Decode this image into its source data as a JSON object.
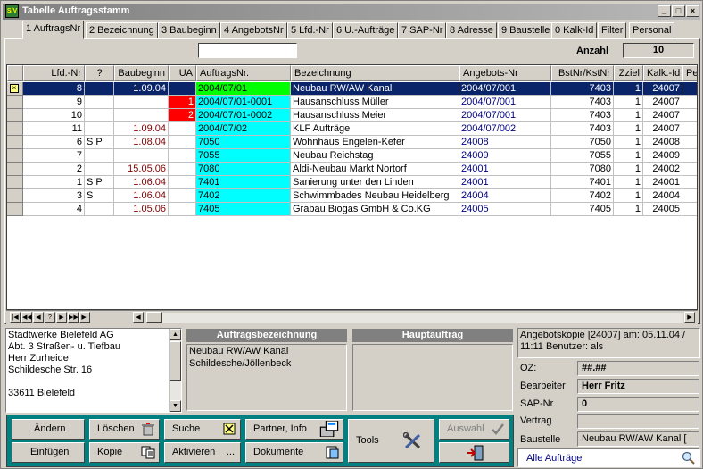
{
  "window": {
    "title": "Tabelle Auftragsstamm",
    "icon_text": "S/V"
  },
  "tabs": [
    "1 AuftragsNr",
    "2 Bezeichnung",
    "3 Baubeginn",
    "4 AngebotsNr",
    "5 Lfd.-Nr",
    "6 U.-Aufträge",
    "7 SAP-Nr",
    "8 Adresse",
    "9 Baustelle",
    "0 Kalk-Id",
    "Filter",
    "Personal"
  ],
  "anzahl": {
    "label": "Anzahl",
    "value": "10"
  },
  "grid": {
    "headers": [
      "Lfd.-Nr",
      "?",
      "Baubeginn",
      "UA",
      "AuftragsNr.",
      "Bezeichnung",
      "Angebots-Nr",
      "BstNr/KstNr",
      "Zziel",
      "Kalk.-Id",
      "Per"
    ],
    "rows": [
      {
        "lfd": "8",
        "q": "",
        "beginn": "1.09.04",
        "ua": "",
        "nr": "2004/07/01",
        "bez": "Neubau RW/AW Kanal",
        "ang": "2004/07/001",
        "bst": "7403",
        "z": "1",
        "kalk": "24007"
      },
      {
        "lfd": "9",
        "q": "",
        "beginn": "",
        "ua": "1",
        "nr": "2004/07/01-0001",
        "bez": "Hausanschluss Müller",
        "ang": "2004/07/001",
        "bst": "7403",
        "z": "1",
        "kalk": "24007"
      },
      {
        "lfd": "10",
        "q": "",
        "beginn": "",
        "ua": "2",
        "nr": "2004/07/01-0002",
        "bez": "Hausanschluss Meier",
        "ang": "2004/07/001",
        "bst": "7403",
        "z": "1",
        "kalk": "24007"
      },
      {
        "lfd": "11",
        "q": "",
        "beginn": "1.09.04",
        "ua": "",
        "nr": "2004/07/02",
        "bez": "KLF Aufträge",
        "ang": "2004/07/002",
        "bst": "7403",
        "z": "1",
        "kalk": "24007"
      },
      {
        "lfd": "6",
        "q": "S P",
        "beginn": "1.08.04",
        "ua": "",
        "nr": "7050",
        "bez": "Wohnhaus Engelen-Kefer",
        "ang": "24008",
        "bst": "7050",
        "z": "1",
        "kalk": "24008"
      },
      {
        "lfd": "7",
        "q": "",
        "beginn": "",
        "ua": "",
        "nr": "7055",
        "bez": "Neubau Reichstag",
        "ang": "24009",
        "bst": "7055",
        "z": "1",
        "kalk": "24009"
      },
      {
        "lfd": "2",
        "q": "",
        "beginn": "15.05.06",
        "ua": "",
        "nr": "7080",
        "bez": "Aldi-Neubau Markt Nortorf",
        "ang": "24001",
        "bst": "7080",
        "z": "1",
        "kalk": "24002"
      },
      {
        "lfd": "1",
        "q": "S P",
        "beginn": "1.06.04",
        "ua": "",
        "nr": "7401",
        "bez": "Sanierung unter den Linden",
        "ang": "24001",
        "bst": "7401",
        "z": "1",
        "kalk": "24001"
      },
      {
        "lfd": "3",
        "q": "S",
        "beginn": "1.06.04",
        "ua": "",
        "nr": "7402",
        "bez": "Schwimmbades Neubau Heidelberg",
        "ang": "24004",
        "bst": "7402",
        "z": "1",
        "kalk": "24004"
      },
      {
        "lfd": "4",
        "q": "",
        "beginn": "1.05.06",
        "ua": "",
        "nr": "7405",
        "bez": "Grabau Biogas GmbH & Co.KG",
        "ang": "24005",
        "bst": "7405",
        "z": "1",
        "kalk": "24005"
      }
    ]
  },
  "address": [
    "Stadtwerke Bielefeld AG",
    "Abt. 3 Straßen- u. Tiefbau",
    "Herr Zurheide",
    "Schildesche Str. 16",
    "",
    "33611 Bielefeld"
  ],
  "auftragsbezeichnung": {
    "header": "Auftragsbezeichnung",
    "lines": [
      "Neubau RW/AW Kanal",
      "Schildesche/Jöllenbeck"
    ]
  },
  "hauptauftrag": {
    "header": "Hauptauftrag"
  },
  "info": {
    "text": "Angebotskopie [24007] am: 05.11.04 / 11:11   Benutzer: als"
  },
  "fields": {
    "oz_label": "OZ:",
    "oz": "##.##",
    "bearbeiter_label": "Bearbeiter",
    "bearbeiter": "Herr Fritz",
    "sap_label": "SAP-Nr",
    "sap": "0",
    "vertrag_label": "Vertrag",
    "vertrag": "",
    "baustelle_label": "Baustelle",
    "baustelle": "Neubau RW/AW Kanal ["
  },
  "filter": {
    "label": "Alle Aufträge"
  },
  "buttons": {
    "aendern": "Ändern",
    "einfuegen": "Einfügen",
    "loeschen": "Löschen",
    "kopie": "Kopie",
    "suche": "Suche",
    "aktivieren": "Aktivieren",
    "partner": "Partner, Info",
    "dokumente": "Dokumente",
    "tools": "Tools",
    "auswahl": "Auswahl"
  },
  "colors": {
    "selected_row": "#0a246a",
    "green_cell": "#00ff00",
    "cyan_cell": "#00ffff",
    "red_cell": "#ff0000",
    "button_panel": "#008080",
    "link": "#000080",
    "date_red": "#800000"
  }
}
